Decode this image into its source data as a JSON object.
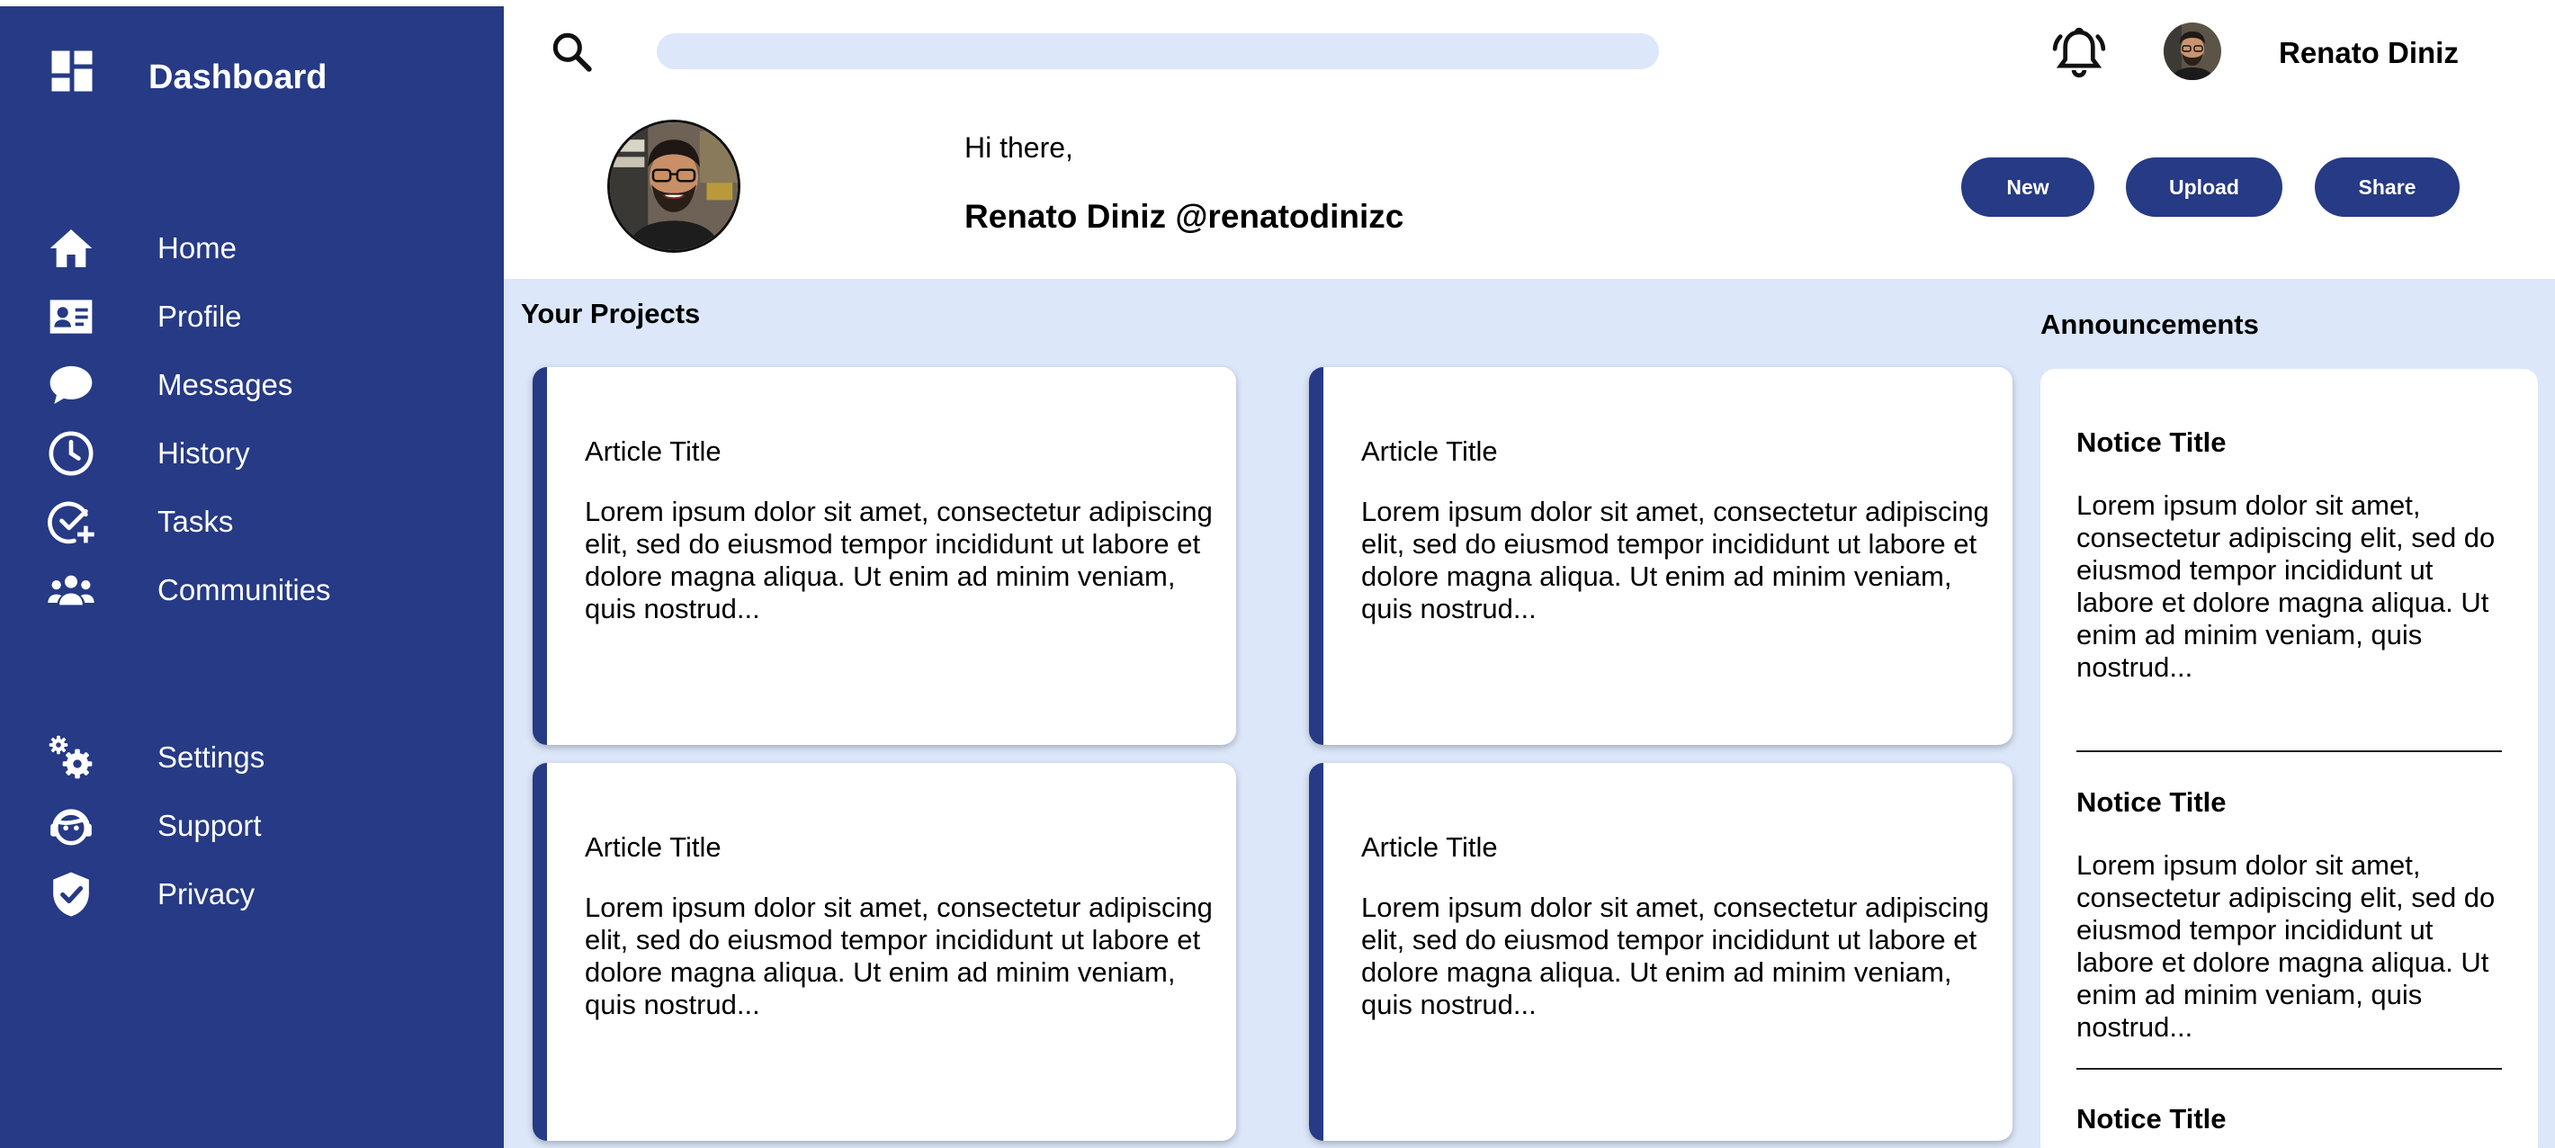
{
  "sidebar": {
    "brand": "Dashboard",
    "items": [
      {
        "label": "Home",
        "icon": "home-icon"
      },
      {
        "label": "Profile",
        "icon": "id-card-icon"
      },
      {
        "label": "Messages",
        "icon": "chat-bubble-icon"
      },
      {
        "label": "History",
        "icon": "clock-icon"
      },
      {
        "label": "Tasks",
        "icon": "task-check-icon"
      },
      {
        "label": "Communities",
        "icon": "people-icon"
      }
    ],
    "secondary_items": [
      {
        "label": "Settings",
        "icon": "gears-icon"
      },
      {
        "label": "Support",
        "icon": "support-agent-icon"
      },
      {
        "label": "Privacy",
        "icon": "shield-check-icon"
      }
    ]
  },
  "header": {
    "search": {
      "value": "",
      "placeholder": ""
    },
    "user_name": "Renato Diniz"
  },
  "profile": {
    "greeting": "Hi there,",
    "handle": "Renato Diniz @renatodinizc"
  },
  "actions": {
    "new_label": "New",
    "upload_label": "Upload",
    "share_label": "Share"
  },
  "projects": {
    "title": "Your Projects",
    "cards": [
      {
        "title": "Article Title",
        "body": "Lorem ipsum dolor sit amet, consectetur adipiscing elit, sed do eiusmod tempor incididunt ut labore et dolore magna aliqua. Ut enim ad minim veniam, quis nostrud..."
      },
      {
        "title": "Article Title",
        "body": "Lorem ipsum dolor sit amet, consectetur adipiscing elit, sed do eiusmod tempor incididunt ut labore et dolore magna aliqua. Ut enim ad minim veniam, quis nostrud..."
      },
      {
        "title": "Article Title",
        "body": "Lorem ipsum dolor sit amet, consectetur adipiscing elit, sed do eiusmod tempor incididunt ut labore et dolore magna aliqua. Ut enim ad minim veniam, quis nostrud..."
      },
      {
        "title": "Article Title",
        "body": "Lorem ipsum dolor sit amet, consectetur adipiscing elit, sed do eiusmod tempor incididunt ut labore et dolore magna aliqua. Ut enim ad minim veniam, quis nostrud..."
      }
    ]
  },
  "announcements": {
    "title": "Announcements",
    "notices": [
      {
        "title": "Notice Title",
        "body": "Lorem ipsum dolor sit amet, consectetur adipiscing elit, sed do eiusmod tempor incididunt ut labore et dolore magna aliqua. Ut enim ad minim veniam, quis nostrud..."
      },
      {
        "title": "Notice Title",
        "body": "Lorem ipsum dolor sit amet, consectetur adipiscing elit, sed do eiusmod tempor incididunt ut labore et dolore magna aliqua. Ut enim ad minim veniam, quis nostrud..."
      },
      {
        "title": "Notice Title",
        "body": ""
      }
    ]
  },
  "colors": {
    "sidebar": "#263a85",
    "accent": "#263a85",
    "content_bg": "#dce7fa"
  }
}
